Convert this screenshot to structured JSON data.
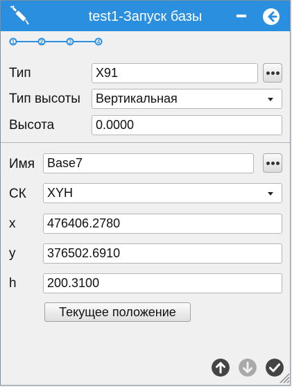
{
  "window": {
    "title": "test1-Запуск базы"
  },
  "steps": [
    "1",
    "2",
    "3",
    "4"
  ],
  "base": {
    "type_label": "Тип",
    "type_value": "X91",
    "height_type_label": "Тип высоты",
    "height_type_value": "Вертикальная",
    "height_label": "Высота",
    "height_value": "0.0000"
  },
  "point": {
    "name_label": "Имя",
    "name_value": "Base7",
    "cs_label": "СК",
    "cs_value": "XYH",
    "x_label": "x",
    "x_value": "476406.2780",
    "y_label": "y",
    "y_value": "376502.6910",
    "h_label": "h",
    "h_value": "200.3100",
    "current_position_label": "Текущее положение"
  },
  "colors": {
    "titlebar": "#2b8fe0",
    "step_accent": "#2b8fe0",
    "nav_button": "#444444",
    "nav_button_disabled": "#a9a9a9"
  },
  "icons": {
    "app": "satellite-icon",
    "minimize": "minimize-icon",
    "back": "arrow-left-circle-icon",
    "up": "arrow-up-circle-icon",
    "down": "arrow-down-circle-icon",
    "ok": "check-circle-icon",
    "resize": "resize-grip-icon"
  }
}
